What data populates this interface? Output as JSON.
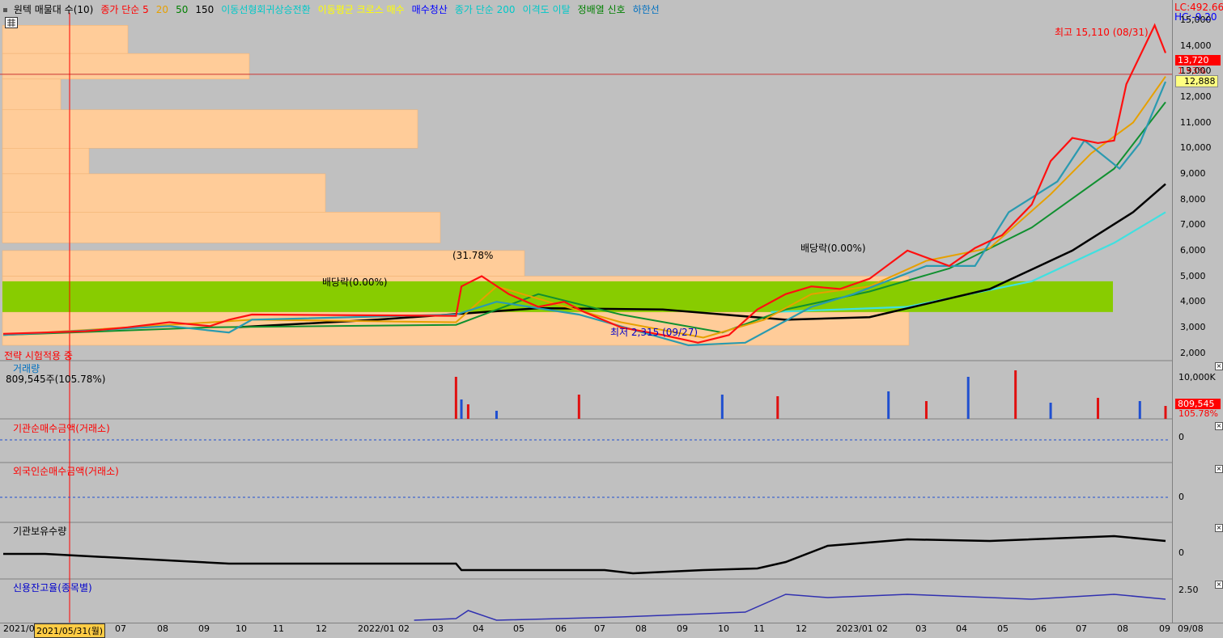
{
  "legend": [
    {
      "text": "원텍 매물대 수(10)",
      "color": "#000000"
    },
    {
      "text": "종가 단순 5",
      "color": "#ff0000"
    },
    {
      "text": "20",
      "color": "#e6a000"
    },
    {
      "text": "50",
      "color": "#008000"
    },
    {
      "text": "150",
      "color": "#000000"
    },
    {
      "text": "이동선형회귀상승전환",
      "color": "#00c8c8"
    },
    {
      "text": "이동평균 크로스 매수",
      "color": "#ffff00"
    },
    {
      "text": "매수청산",
      "color": "#0000ff"
    },
    {
      "text": "종가 단순 200",
      "color": "#00c8c8"
    },
    {
      "text": "이격도 이탈",
      "color": "#00c8c8"
    },
    {
      "text": "정배열 신호",
      "color": "#008000"
    },
    {
      "text": "하한선",
      "color": "#0070c0"
    }
  ],
  "header_right": {
    "lc": "LC:492.66",
    "hc": "HC:-9.20"
  },
  "price_tags": {
    "last": "13,720",
    "pct": "1.93%",
    "line": "12,888"
  },
  "annotations": {
    "high": "최고 15,110 (08/31)",
    "low": "최저 2,315 (09/27)",
    "div1": "배당락(0.00%)",
    "div2": "배당락(0.00%)",
    "pct": "(31.78%"
  },
  "status_text": "전략 시험적용 중",
  "panels": {
    "volume": {
      "title": "거래량",
      "sub": "809,545주(105.78%)",
      "tick": "10,000K",
      "tag1": "809,545",
      "tag2": "105.78%"
    },
    "inst": {
      "title": "기관순매수금액(거래소)",
      "tick": "0"
    },
    "foreign": {
      "title": "외국인순매수금액(거래소)",
      "tick": "0"
    },
    "hold": {
      "title": "기관보유수량",
      "tick": "0"
    },
    "credit": {
      "title": "신용잔고율(종목별)",
      "tick": "2.50"
    }
  },
  "x_axis_labels": [
    "2021/0",
    "2021/05/31(월)",
    "07",
    "08",
    "09",
    "10",
    "11",
    "12",
    "2022/01",
    "02",
    "03",
    "04",
    "05",
    "06",
    "07",
    "08",
    "09",
    "10",
    "11",
    "12",
    "2023/01",
    "02",
    "03",
    "04",
    "05",
    "06",
    "07",
    "08",
    "09",
    "09/08"
  ],
  "chart_data": {
    "type": "candlestick",
    "title": "원텍 매물대 수(10)",
    "y_ticks": [
      2000,
      3000,
      4000,
      5000,
      6000,
      7000,
      8000,
      9000,
      10000,
      11000,
      12000,
      13000,
      14000,
      15000
    ],
    "ylim": [
      1700,
      15600
    ],
    "x_start": "2021-05-01",
    "x_end": "2023-09-08",
    "close_series": [
      [
        "2021-05-01",
        2750
      ],
      [
        "2021-06-01",
        2800
      ],
      [
        "2021-07-01",
        2850
      ],
      [
        "2021-08-01",
        3000
      ],
      [
        "2021-09-01",
        3200
      ],
      [
        "2021-10-01",
        3050
      ],
      [
        "2021-10-15",
        3300
      ],
      [
        "2021-11-01",
        3500
      ],
      [
        "2022-04-01",
        3450
      ],
      [
        "2022-04-05",
        4600
      ],
      [
        "2022-04-20",
        5000
      ],
      [
        "2022-05-10",
        4300
      ],
      [
        "2022-06-01",
        3800
      ],
      [
        "2022-06-20",
        4000
      ],
      [
        "2022-07-05",
        3600
      ],
      [
        "2022-08-01",
        3000
      ],
      [
        "2022-09-01",
        2700
      ],
      [
        "2022-09-27",
        2400
      ],
      [
        "2022-10-20",
        2700
      ],
      [
        "2022-11-10",
        3700
      ],
      [
        "2022-12-01",
        4300
      ],
      [
        "2022-12-20",
        4600
      ],
      [
        "2023-01-10",
        4500
      ],
      [
        "2023-02-01",
        4900
      ],
      [
        "2023-03-01",
        6000
      ],
      [
        "2023-04-01",
        5400
      ],
      [
        "2023-04-20",
        6100
      ],
      [
        "2023-05-10",
        6600
      ],
      [
        "2023-06-01",
        7800
      ],
      [
        "2023-06-15",
        9500
      ],
      [
        "2023-07-01",
        10400
      ],
      [
        "2023-07-20",
        10200
      ],
      [
        "2023-08-01",
        10300
      ],
      [
        "2023-08-10",
        12500
      ],
      [
        "2023-08-31",
        14800
      ],
      [
        "2023-09-08",
        13720
      ]
    ],
    "ma20": [
      [
        "2021-05-01",
        2700
      ],
      [
        "2021-09-01",
        3100
      ],
      [
        "2021-11-01",
        3300
      ],
      [
        "2022-04-01",
        3200
      ],
      [
        "2022-05-01",
        4600
      ],
      [
        "2022-06-15",
        3900
      ],
      [
        "2022-08-01",
        3200
      ],
      [
        "2022-10-01",
        2600
      ],
      [
        "2022-11-15",
        3300
      ],
      [
        "2022-12-20",
        4300
      ],
      [
        "2023-02-01",
        4600
      ],
      [
        "2023-03-15",
        5600
      ],
      [
        "2023-05-01",
        6100
      ],
      [
        "2023-06-15",
        8200
      ],
      [
        "2023-07-15",
        9800
      ],
      [
        "2023-08-15",
        11000
      ],
      [
        "2023-09-08",
        12800
      ]
    ],
    "ma50": [
      [
        "2021-05-01",
        2700
      ],
      [
        "2021-10-01",
        3000
      ],
      [
        "2022-04-01",
        3100
      ],
      [
        "2022-06-01",
        4300
      ],
      [
        "2022-08-01",
        3500
      ],
      [
        "2022-10-15",
        2800
      ],
      [
        "2022-12-01",
        3700
      ],
      [
        "2023-02-01",
        4400
      ],
      [
        "2023-04-01",
        5300
      ],
      [
        "2023-06-01",
        6900
      ],
      [
        "2023-08-01",
        9200
      ],
      [
        "2023-09-08",
        11800
      ]
    ],
    "ma150": [
      [
        "2021-10-20",
        3000
      ],
      [
        "2022-02-01",
        3300
      ],
      [
        "2022-06-01",
        3750
      ],
      [
        "2022-09-01",
        3700
      ],
      [
        "2022-12-01",
        3300
      ],
      [
        "2023-02-01",
        3400
      ],
      [
        "2023-05-01",
        4500
      ],
      [
        "2023-07-01",
        6000
      ],
      [
        "2023-08-15",
        7500
      ],
      [
        "2023-09-08",
        8600
      ]
    ],
    "ma200": [
      [
        "2022-11-20",
        3600
      ],
      [
        "2023-03-01",
        3800
      ],
      [
        "2023-06-01",
        4800
      ],
      [
        "2023-08-01",
        6300
      ],
      [
        "2023-09-08",
        7500
      ]
    ],
    "lower_band": [
      [
        "2021-05-01",
        2700
      ],
      [
        "2021-09-01",
        3050
      ],
      [
        "2021-10-15",
        2800
      ],
      [
        "2021-11-01",
        3300
      ],
      [
        "2022-04-01",
        3500
      ],
      [
        "2022-05-01",
        4000
      ],
      [
        "2022-07-01",
        3500
      ],
      [
        "2022-09-20",
        2300
      ],
      [
        "2022-11-01",
        2400
      ],
      [
        "2022-12-20",
        3800
      ],
      [
        "2023-01-20",
        4300
      ],
      [
        "2023-03-15",
        5400
      ],
      [
        "2023-04-20",
        5400
      ],
      [
        "2023-05-15",
        7500
      ],
      [
        "2023-06-20",
        8700
      ],
      [
        "2023-07-10",
        10300
      ],
      [
        "2023-08-05",
        9200
      ],
      [
        "2023-08-20",
        10200
      ],
      [
        "2023-09-08",
        12600
      ]
    ],
    "volume_profile": [
      {
        "price_from": 13700,
        "price_to": 14800,
        "volume": 155
      },
      {
        "price_from": 12700,
        "price_to": 13700,
        "volume": 305
      },
      {
        "price_from": 11500,
        "price_to": 12700,
        "volume": 72
      },
      {
        "price_from": 10000,
        "price_to": 11500,
        "volume": 513
      },
      {
        "price_from": 9000,
        "price_to": 10000,
        "volume": 107
      },
      {
        "price_from": 7500,
        "price_to": 9000,
        "volume": 399
      },
      {
        "price_from": 6300,
        "price_to": 7500,
        "volume": 541
      },
      {
        "price_from": 5000,
        "price_to": 6000,
        "volume": 645
      },
      {
        "price_from": 4000,
        "price_to": 5000,
        "volume": 1120
      },
      {
        "price_from": 2300,
        "price_to": 3600,
        "volume": 1120
      }
    ],
    "highlight_band": {
      "price_from": 3600,
      "price_to": 4800
    },
    "reference_price": 12888,
    "volume_bars": [
      [
        "2022-04-01",
        52
      ],
      [
        "2022-04-05",
        24
      ],
      [
        "2022-04-10",
        18
      ],
      [
        "2022-05-01",
        10
      ],
      [
        "2022-07-01",
        30
      ],
      [
        "2022-10-15",
        30
      ],
      [
        "2022-11-25",
        28
      ],
      [
        "2023-02-15",
        34
      ],
      [
        "2023-03-15",
        22
      ],
      [
        "2023-04-15",
        52
      ],
      [
        "2023-05-20",
        60
      ],
      [
        "2023-06-15",
        20
      ],
      [
        "2023-07-20",
        26
      ],
      [
        "2023-08-20",
        22
      ],
      [
        "2023-09-08",
        16
      ]
    ],
    "institution_holdings": [
      [
        "2021-05-01",
        0
      ],
      [
        "2021-06-01",
        0
      ],
      [
        "2021-10-15",
        -12
      ],
      [
        "2022-04-01",
        -12
      ],
      [
        "2022-04-05",
        -20
      ],
      [
        "2022-07-20",
        -20
      ],
      [
        "2022-08-10",
        -24
      ],
      [
        "2022-10-01",
        -20
      ],
      [
        "2022-11-10",
        -18
      ],
      [
        "2022-12-01",
        -10
      ],
      [
        "2023-01-01",
        10
      ],
      [
        "2023-03-01",
        18
      ],
      [
        "2023-05-01",
        16
      ],
      [
        "2023-08-01",
        22
      ],
      [
        "2023-09-08",
        16
      ]
    ],
    "credit_ratio": [
      [
        "2022-03-01",
        -30
      ],
      [
        "2022-04-01",
        -28
      ],
      [
        "2022-04-10",
        -18
      ],
      [
        "2022-05-01",
        -30
      ],
      [
        "2022-08-01",
        -26
      ],
      [
        "2022-11-01",
        -20
      ],
      [
        "2022-12-01",
        2
      ],
      [
        "2023-01-01",
        -2
      ],
      [
        "2023-03-01",
        2
      ],
      [
        "2023-06-01",
        -4
      ],
      [
        "2023-08-01",
        2
      ],
      [
        "2023-09-08",
        -4
      ]
    ]
  }
}
